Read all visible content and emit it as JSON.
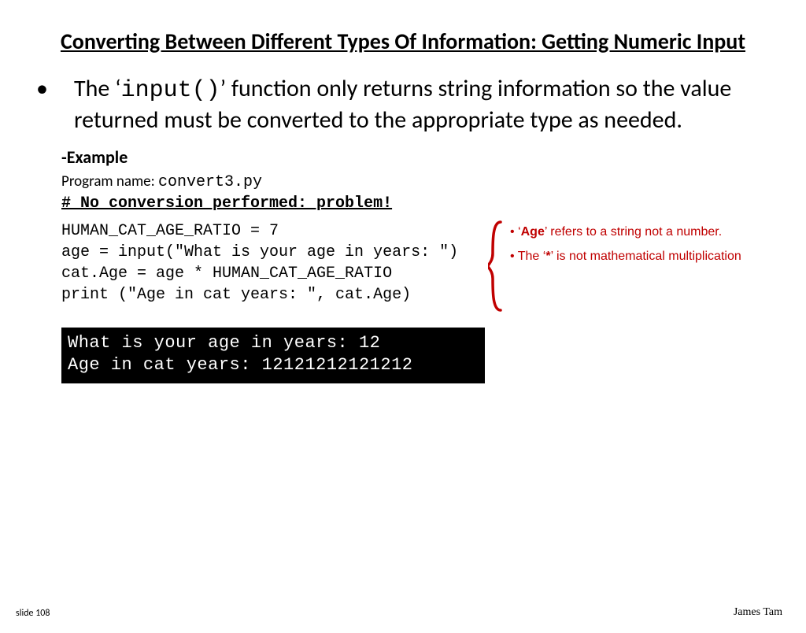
{
  "title": "Converting Between Different Types Of Information: Getting Numeric Input",
  "bullet": {
    "pre": "The ‘",
    "code": "input()",
    "post": "’ function only returns string information so the value returned must be converted to the appropriate type as needed."
  },
  "example_label": "-Example",
  "program": {
    "label": "Program name: ",
    "file": "convert3.py",
    "comment": "# No conversion performed: problem!",
    "code": "HUMAN_CAT_AGE_RATIO = 7\nage = input(\"What is your age in years: \")\ncat.Age = age * HUMAN_CAT_AGE_RATIO\nprint (\"Age in cat years: \", cat.Age)"
  },
  "notes": {
    "n1_pre": "• ‘",
    "n1_b": "Age",
    "n1_post": "’ refers to a string not a number.",
    "n2_pre": "• The ‘",
    "n2_b": "*",
    "n2_post": "’ is not mathematical multiplication"
  },
  "terminal": {
    "line1": "What is your age in years: 12",
    "line2": "Age in cat years:  12121212121212"
  },
  "footer": {
    "left": "slide 108",
    "right": "James Tam"
  }
}
